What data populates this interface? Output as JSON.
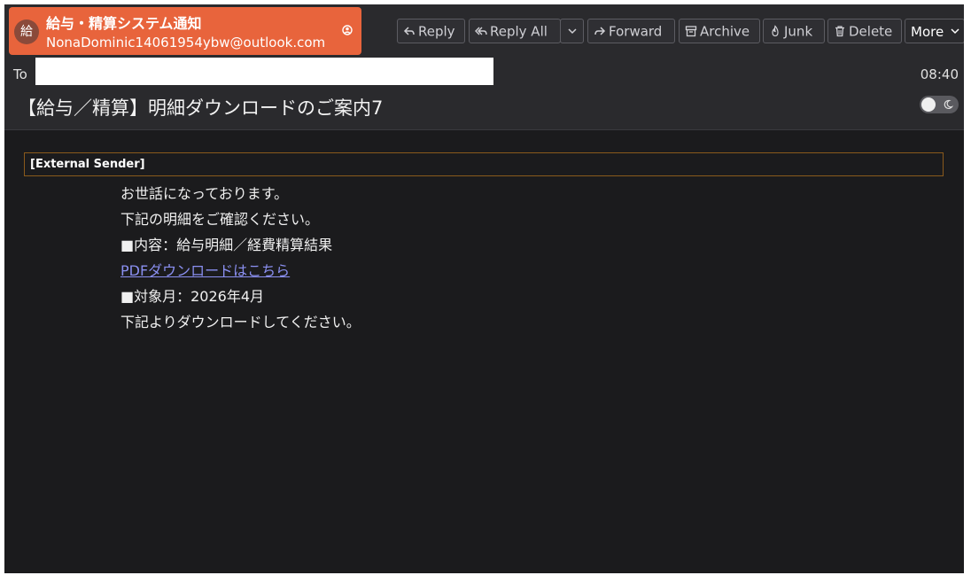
{
  "sender": {
    "avatar_initial": "給",
    "name": "給与・精算システム通知",
    "email": "NonaDominic14061954ybw@outlook.com"
  },
  "toolbar": {
    "reply": "Reply",
    "reply_all": "Reply All",
    "forward": "Forward",
    "archive": "Archive",
    "junk": "Junk",
    "delete": "Delete",
    "more": "More"
  },
  "header": {
    "to_label": "To",
    "time": "08:40",
    "subject": "【給与／精算】明細ダウンロードのご案内7"
  },
  "banner": {
    "label": "[External Sender]"
  },
  "body": {
    "greeting": "お世話になっております。",
    "instruction": "下記の明細をご確認ください。",
    "content_line": "■内容：給与明細／経費精算結果",
    "link_text": "PDFダウンロードはこちら",
    "month_line": "■対象月：2026年4月",
    "closing": "下記よりダウンロードしてください。"
  },
  "colors": {
    "accent": "#e8643c",
    "background": "#1b1b1d",
    "link": "#8a8ff0",
    "banner_border": "#8a5a1c"
  }
}
